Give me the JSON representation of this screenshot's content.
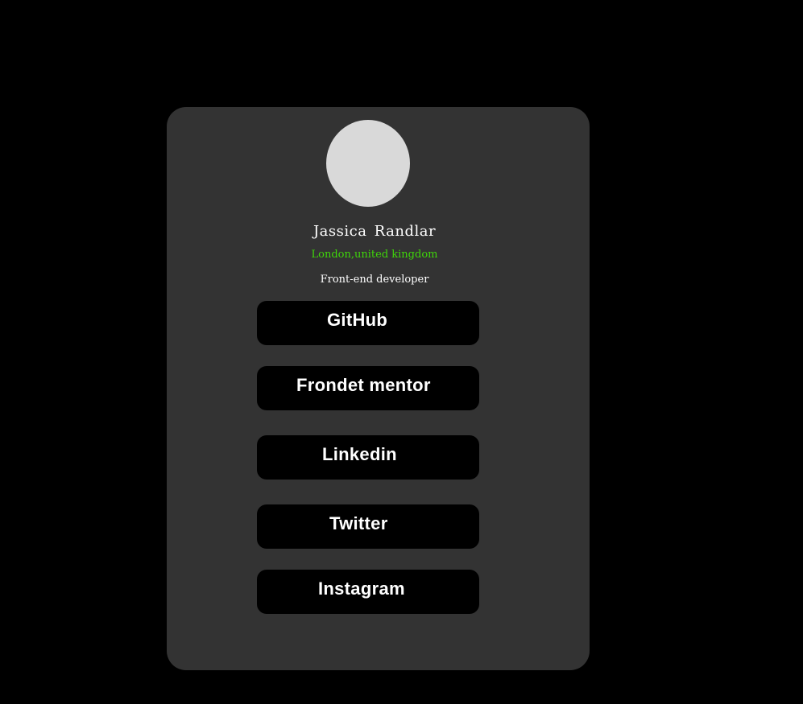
{
  "profile": {
    "name": "Jassica  Randlar",
    "location": "London,united kingdom",
    "role": "Front-end developer"
  },
  "links": [
    {
      "label": "GitHub"
    },
    {
      "label": "Frondet mentor"
    },
    {
      "label": "Linkedin"
    },
    {
      "label": "Twitter"
    },
    {
      "label": "Instagram"
    }
  ],
  "colors": {
    "page_background": "#000000",
    "card_background": "#333333",
    "avatar": "#d9d9d9",
    "location_text": "#3fd60a",
    "button_background": "#000000",
    "text": "#ffffff"
  }
}
